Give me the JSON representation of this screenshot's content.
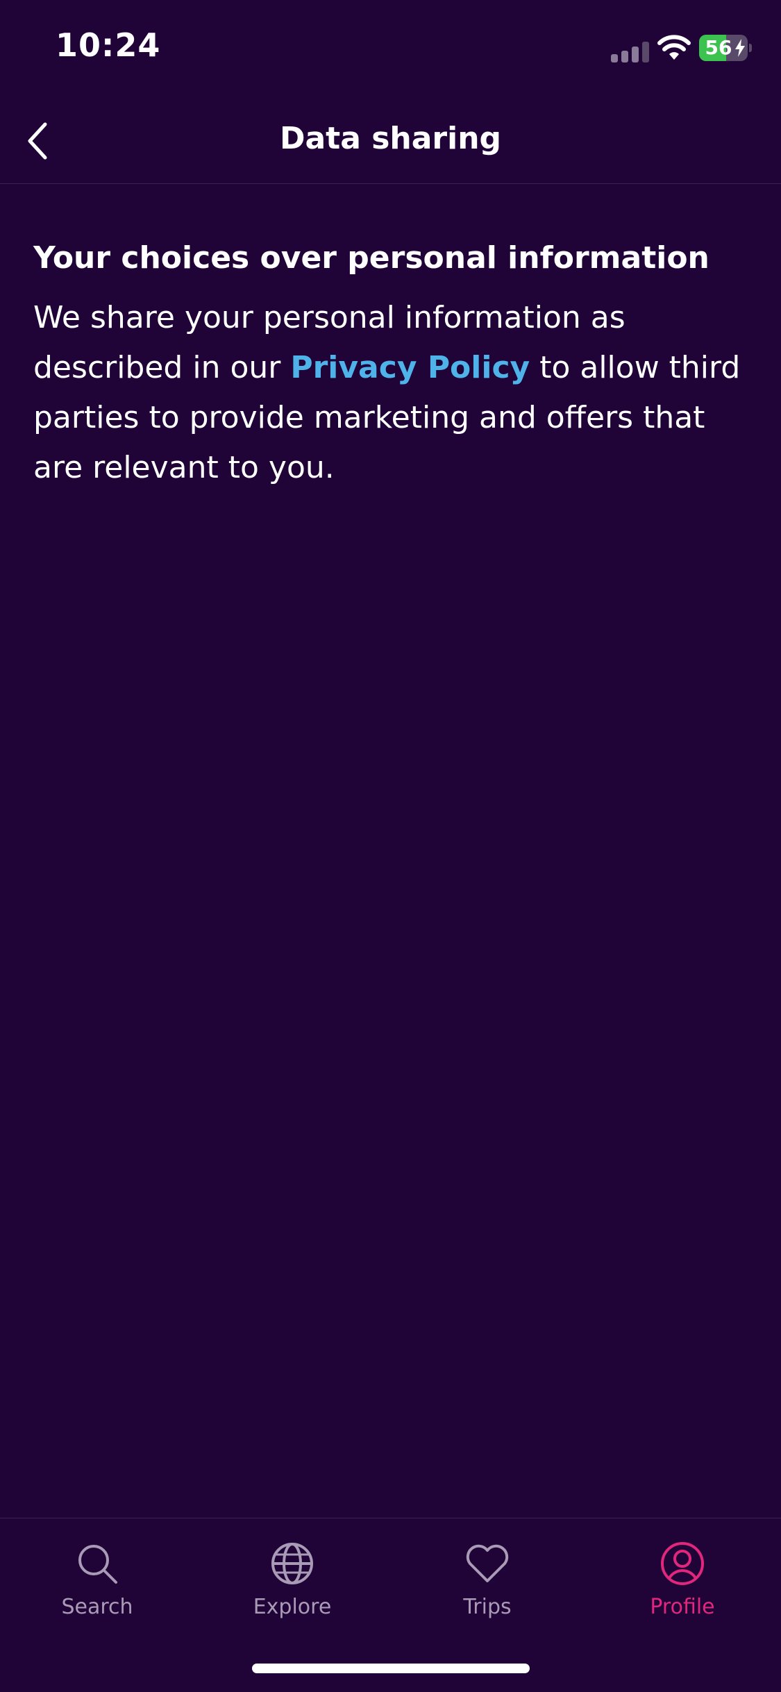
{
  "status_bar": {
    "time": "10:24",
    "battery_level": "56",
    "battery_fraction": 0.56,
    "battery_color": "#3cc24f"
  },
  "header": {
    "title": "Data sharing",
    "back_icon": "chevron-left-icon"
  },
  "main": {
    "heading": "Your choices over personal information",
    "description_before": "We share your personal information as described in our ",
    "link_text": "Privacy Policy",
    "description_after": " to allow third parties to provide marketing and offers that are relevant to you.",
    "link_color": "#4fb3ea"
  },
  "tab_bar": {
    "active_color": "#e0267d",
    "inactive_color": "#a99bb5",
    "tabs": [
      {
        "label": "Search",
        "icon": "search-icon",
        "active": false
      },
      {
        "label": "Explore",
        "icon": "globe-icon",
        "active": false
      },
      {
        "label": "Trips",
        "icon": "heart-icon",
        "active": false
      },
      {
        "label": "Profile",
        "icon": "user-icon",
        "active": true
      }
    ]
  },
  "theme": {
    "background": "#200438"
  }
}
